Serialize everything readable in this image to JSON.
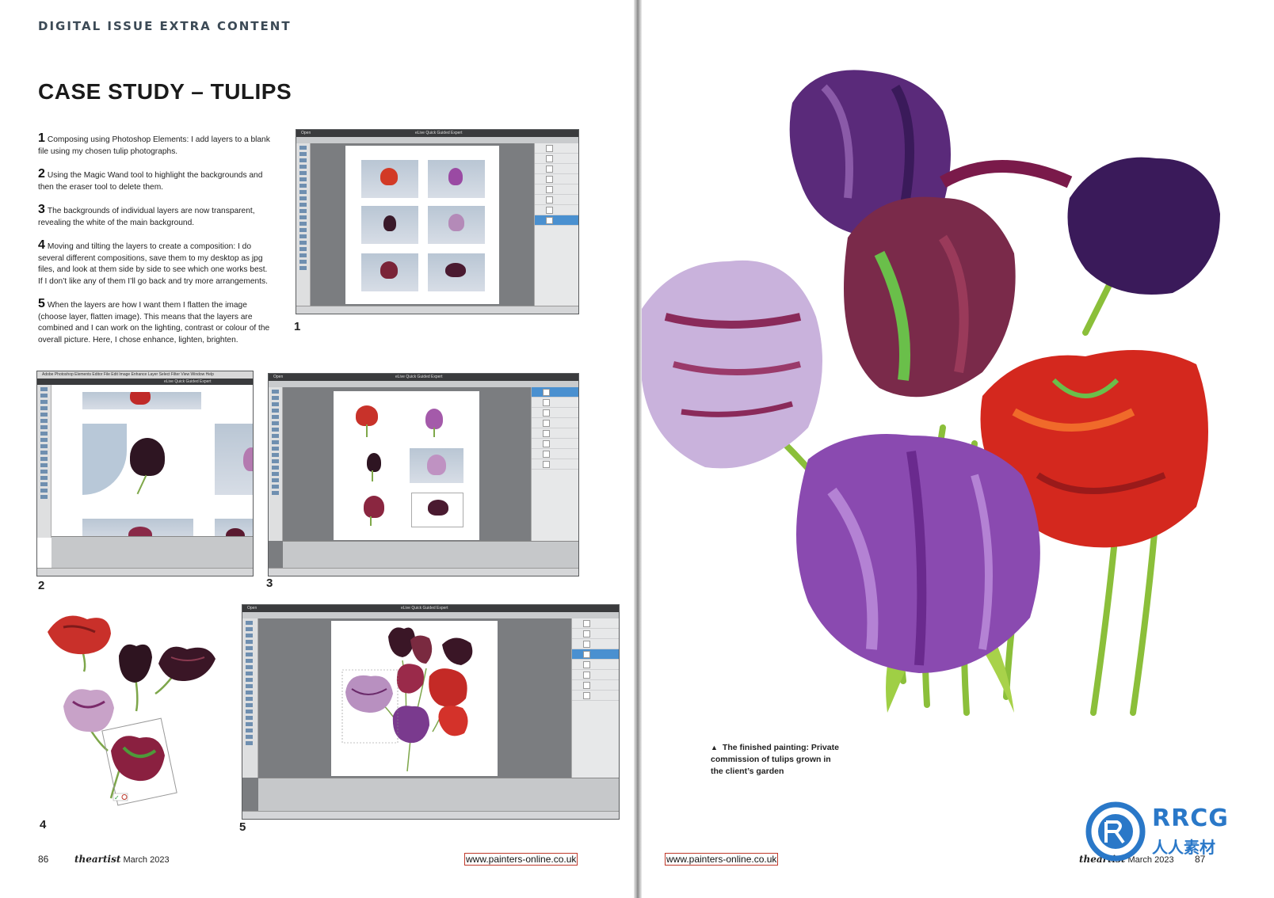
{
  "kicker": "DIGITAL ISSUE EXTRA CONTENT",
  "title": "CASE STUDY – TULIPS",
  "steps": [
    {
      "num": "1",
      "text": "Composing using Photoshop Elements: I add layers to a blank file using my chosen tulip photographs."
    },
    {
      "num": "2",
      "text": "Using the Magic Wand tool to highlight the backgrounds and then the eraser tool to delete them."
    },
    {
      "num": "3",
      "text": "The backgrounds of individual layers are now transparent, revealing the white of the main background."
    },
    {
      "num": "4",
      "text": "Moving and tilting the layers to create a composition: I do several different compositions, save them to my desktop as jpg files, and look at them side by side to see which one works best. If I don’t like any of them I’ll go back and try more arrangements."
    },
    {
      "num": "5",
      "text": "When the layers are how I want them I flatten the image (choose layer, flatten image). This means that the layers are combined and I can work on the lighting, contrast or colour of the overall picture. Here, I chose enhance, lighten, brighten."
    }
  ],
  "figures": {
    "f1": "1",
    "f2": "2",
    "f3": "3",
    "f4": "4",
    "f5": "5"
  },
  "screens": {
    "app_menu": "Adobe Photoshop Elements Editor   File   Edit   Image   Enhance   Layer   Select   Filter   View   Window   Help",
    "open_label": "Open",
    "mode_tabs": "eLive   Quick   Guided   Expert"
  },
  "caption": "The finished painting: Private commission of tulips grown in the client’s garden",
  "caption_marker": "▲",
  "footer": {
    "left_folio": "86",
    "right_folio": "87",
    "brand_the": "the",
    "brand_artist": "artist",
    "issue": "March 2023",
    "url": "www.painters-online.co.uk"
  },
  "watermark": {
    "main": "RRCG",
    "sub": "人人素材"
  },
  "colors": {
    "accent_red": "#c0392b",
    "kicker": "#3c4a56",
    "ui_dark": "#3a3b3d",
    "ui_select": "#4a90d0"
  }
}
